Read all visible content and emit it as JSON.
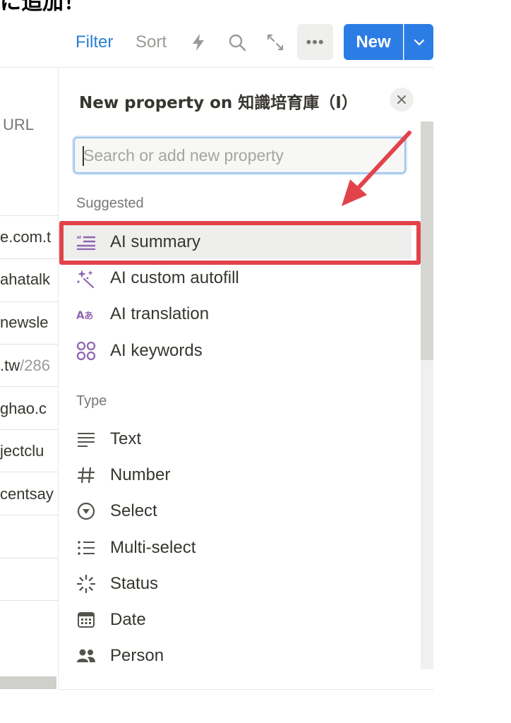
{
  "heading": {
    "text": "に追加！"
  },
  "toolbar": {
    "filter_label": "Filter",
    "sort_label": "Sort",
    "lightning_icon": "lightning-icon",
    "search_icon": "search-icon",
    "expand_icon": "expand-icon",
    "more_label": "•••",
    "new_label": "New",
    "new_dropdown_icon": "chevron-down-icon",
    "accent_color": "#2c7ce5"
  },
  "table": {
    "column_header": "URL",
    "cells": [
      {
        "main": "e.com.t",
        "dim": ""
      },
      {
        "main": "ahatalk",
        "dim": ""
      },
      {
        "main": "newsle",
        "dim": ""
      },
      {
        "main": ".tw",
        "dim": "/286"
      },
      {
        "main": "ghao.c",
        "dim": ""
      },
      {
        "main": "jectclu",
        "dim": ""
      },
      {
        "main": "centsay",
        "dim": ""
      }
    ]
  },
  "panel": {
    "title": "New property on 知識培育庫（I）",
    "close_icon": "close-icon",
    "search_placeholder": "Search or add new property",
    "suggested_label": "Suggested",
    "suggested": [
      {
        "label": "AI summary",
        "icon": "ai-summary-icon",
        "highlighted": true
      },
      {
        "label": "AI custom autofill",
        "icon": "sparkle-icon"
      },
      {
        "label": "AI translation",
        "icon": "translation-icon"
      },
      {
        "label": "AI keywords",
        "icon": "keywords-icon"
      }
    ],
    "type_label": "Type",
    "types": [
      {
        "label": "Text",
        "icon": "text-lines-icon"
      },
      {
        "label": "Number",
        "icon": "hash-icon"
      },
      {
        "label": "Select",
        "icon": "select-circle-icon"
      },
      {
        "label": "Multi-select",
        "icon": "list-icon"
      },
      {
        "label": "Status",
        "icon": "status-spinner-icon"
      },
      {
        "label": "Date",
        "icon": "calendar-icon"
      },
      {
        "label": "Person",
        "icon": "people-icon"
      }
    ],
    "highlight_color": "#e2434b"
  }
}
